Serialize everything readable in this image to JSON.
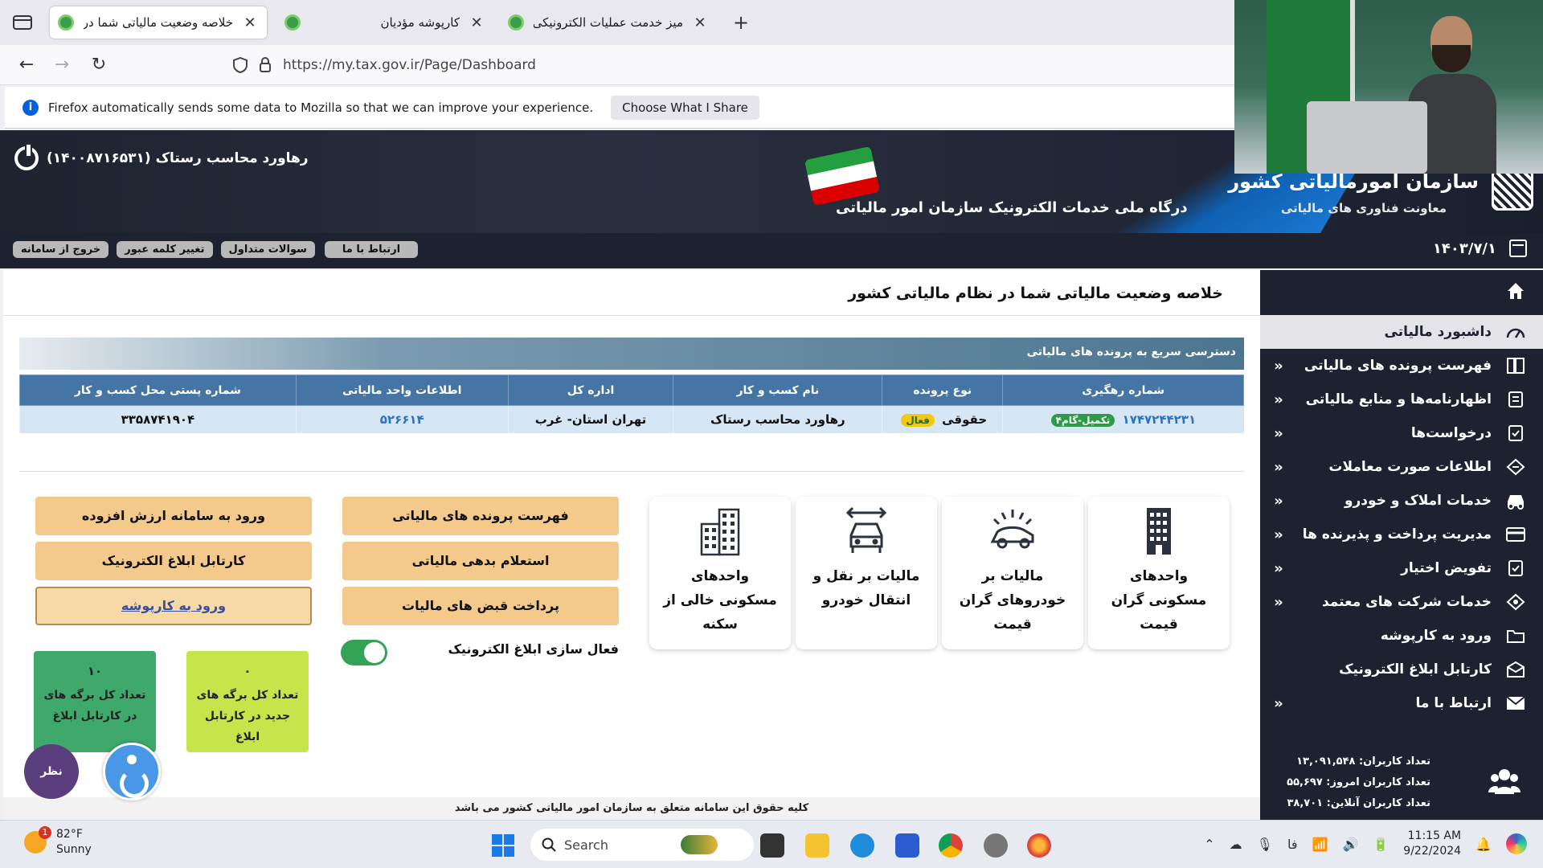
{
  "browser": {
    "tabs": [
      {
        "title": "خلاصه وضعیت مالیاتی شما در نـ",
        "active": true
      },
      {
        "title": "کارپوشه مؤدیان",
        "active": false
      },
      {
        "title": "میز خدمت عملیات الکترونیکی ما",
        "active": false
      }
    ],
    "new_tab": "+",
    "url": "https://my.tax.gov.ir/Page/Dashboard",
    "notification": {
      "message": "Firefox automatically sends some data to Mozilla so that we can improve your experience.",
      "button": "Choose What I Share"
    }
  },
  "header": {
    "user": "رهاورد محاسب رستاک (۱۴۰۰۸۷۱۶۵۳۱)",
    "portal_subtitle": "درگاه ملی خدمات الکترونیک سازمان امور مالیاتی",
    "org_title": "سازمان امورمالیاتی کشور",
    "org_subtitle": "معاونت فناوری های مالیاتی"
  },
  "toolbar": {
    "buttons": [
      "خروج از سامانه",
      "تغییر کلمه عبور",
      "سوالات متداول",
      "ارتباط با ما"
    ],
    "date": "۱۴۰۳/۷/۱"
  },
  "main": {
    "page_title": "خلاصه وضعیت مالیاتی شما در نظام مالیاتی کشور",
    "quick_access_title": "دسترسی سریع به پرونده های مالیاتی",
    "table": {
      "headers": [
        "شماره رهگیری",
        "نوع پرونده",
        "نام کسب و کار",
        "اداره کل",
        "اطلاعات واحد مالیاتی",
        "شماره پستی محل کسب و کار"
      ],
      "row": {
        "tracking_no": "۱۷۴۷۲۴۴۲۳۱",
        "tracking_badge": "تکمیل-گام۴",
        "file_type": "حقوقی",
        "file_badge": "فعال",
        "business_name": "رهاورد محاسب رستاک",
        "general_office": "تهران استان- غرب",
        "unit_info": "۵۲۶۶۱۴",
        "postal_code": "۳۳۵۸۷۴۱۹۰۴"
      }
    },
    "cards": [
      {
        "label": "واحدهای مسکونی گران قیمت",
        "icon": "building-icon"
      },
      {
        "label": "مالیات بر خودروهای گران قیمت",
        "icon": "luxury-car-icon"
      },
      {
        "label": "مالیات بر نقل و انتقال خودرو",
        "icon": "car-transfer-icon"
      },
      {
        "label": "واحدهای مسکونی خالی از سکنه",
        "icon": "apartment-icon"
      }
    ],
    "buttons_mid": [
      "فهرست پرونده های مالیاتی",
      "استعلام بدهی مالیاتی",
      "پرداخت قبض های مالیات"
    ],
    "buttons_left": [
      "ورود به سامانه ارزش افزوده",
      "کارتابل ابلاغ الکترونیک",
      "ورود به کارپوشه"
    ],
    "toggle": {
      "label": "فعال سازی ابلاغ الکترونیک",
      "on": true
    },
    "stats": [
      {
        "num": "۰",
        "label": "تعداد کل برگه های جدید در کارتابل ابلاغ",
        "color": "#c7e44a"
      },
      {
        "num": "۱۰",
        "label": "تعداد کل برگه های در کارتابل ابلاغ",
        "color": "#3fa86b"
      }
    ],
    "footer": "کلیه حقوق این سامانه متعلق به سازمان امور مالیاتی کشور می باشد",
    "poll_button": "نظر سنجی"
  },
  "sidebar": {
    "items": [
      {
        "label": "داشبورد مالیاتی",
        "icon": "dashboard-icon",
        "active": true
      },
      {
        "label": "فهرست پرونده های مالیاتی",
        "icon": "files-list-icon"
      },
      {
        "label": "اظهارنامه‌ها و منابع مالیاتی",
        "icon": "declaration-icon"
      },
      {
        "label": "درخواست‌ها",
        "icon": "request-icon"
      },
      {
        "label": "اطلاعات صورت معاملات",
        "icon": "transactions-icon"
      },
      {
        "label": "خدمات املاک و خودرو",
        "icon": "car-icon"
      },
      {
        "label": "مدیریت پرداخت و پذیرنده ها",
        "icon": "card-icon"
      },
      {
        "label": "تفویض اختیار",
        "icon": "delegation-icon"
      },
      {
        "label": "خدمات شرکت های معتمد",
        "icon": "trusted-icon"
      },
      {
        "label": "ورود به کارپوشه",
        "icon": "folder-icon"
      },
      {
        "label": "کارتابل ابلاغ الکترونیک",
        "icon": "inbox-icon"
      },
      {
        "label": "ارتباط با ما",
        "icon": "mail-icon"
      }
    ],
    "chevron": "«",
    "stats": [
      "تعداد کاربران: ۱۳,۰۹۱,۵۴۸",
      "تعداد کاربران امروز: ۵۵,۶۹۷",
      "تعداد کاربران آنلاین: ۳۸,۷۰۱"
    ]
  },
  "taskbar": {
    "temp": "82°F",
    "condition": "Sunny",
    "weather_badge": "1",
    "search": "Search",
    "lang": "فا",
    "time": "11:15 AM",
    "date": "9/22/2024"
  },
  "colors": {
    "accent_blue": "#4575a4",
    "button_orange": "#f3c98c",
    "sidebar_bg": "#1d2130",
    "toggle_green": "#35a356"
  }
}
